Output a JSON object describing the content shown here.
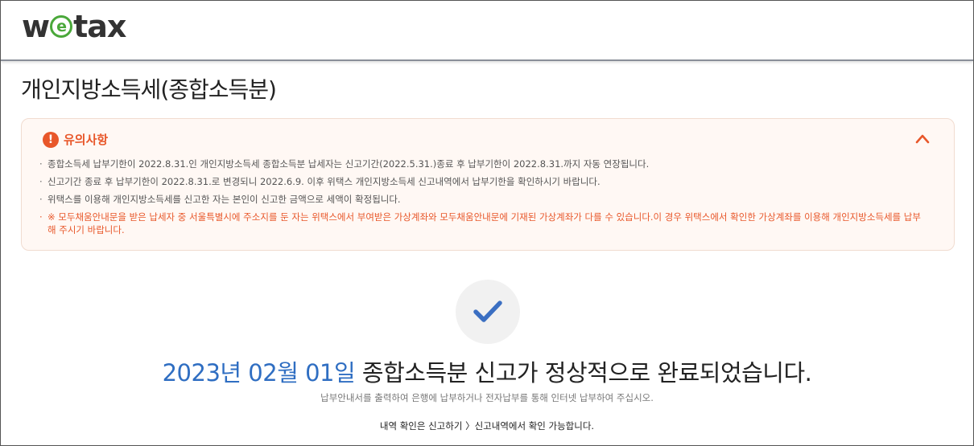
{
  "header": {
    "logo": {
      "prefix": "w",
      "e_mark": "e",
      "suffix": "tax"
    }
  },
  "page": {
    "title": "개인지방소득세(종합소득분)"
  },
  "notice": {
    "alert_icon": "!",
    "title": "유의사항",
    "toggle_icon": "chevron-up-icon",
    "items": [
      "종합소득세 납부기한이 2022.8.31.인 개인지방소득세 종합소득분 납세자는 신고기간(2022.5.31.)종료 후 납부기한이 2022.8.31.까지 자동 연장됩니다.",
      "신고기간 종료 후 납부기한이 2022.8.31.로 변경되니 2022.6.9. 이후 위택스 개인지방소득세 신고내역에서 납부기한을 확인하시기 바랍니다.",
      "위택스를 이용해 개인지방소득세를 신고한 자는 본인이 신고한 금액으로 세액이 확정됩니다.",
      "※ 모두채움안내문을 받은 납세자 중 서울특별시에 주소지를 둔 자는 위택스에서 부여받은 가상계좌와 모두채움안내문에 기재된 가상계좌가 다를 수 있습니다.이 경우 위택스에서 확인한 가상계좌를 이용해 개인지방소득세를 납부해 주시기 바랍니다."
    ]
  },
  "result": {
    "check_icon": "checkmark-icon",
    "date": "2023년 02월 01일",
    "message": " 종합소득분 신고가 정상적으로 완료되었습니다.",
    "sub_message": "납부안내서를 출력하여 은행에 납부하거나 전자납부를 통해 인터넷 납부하여 주십시오.",
    "link_text": "내역 확인은 신고하기 〉신고내역에서 확인 가능합니다."
  },
  "colors": {
    "accent": "#e8572a",
    "date_blue": "#2f6ec2",
    "check_blue": "#3b6fc2",
    "logo_green": "#4aa83a"
  }
}
